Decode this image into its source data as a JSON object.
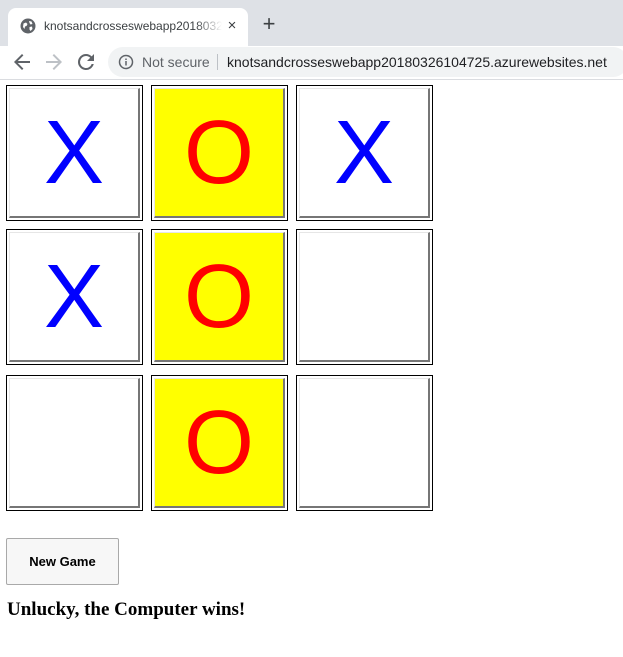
{
  "browser": {
    "tab_title": "knotsandcrosseswebapp20180326104725",
    "close_glyph": "×",
    "new_tab_glyph": "+",
    "security_label": "Not secure",
    "url": "knotsandcrosseswebapp20180326104725.azurewebsites.net"
  },
  "colors": {
    "x_mark": "#0000ff",
    "o_mark": "#ff0000",
    "winning_cell": "#ffff00"
  },
  "board": {
    "cells": [
      "X",
      "O",
      "X",
      "X",
      "O",
      "",
      "",
      "O",
      ""
    ],
    "winning_line": [
      1,
      4,
      7
    ]
  },
  "new_game_label": "New Game",
  "result_message": "Unlucky, the Computer wins!"
}
